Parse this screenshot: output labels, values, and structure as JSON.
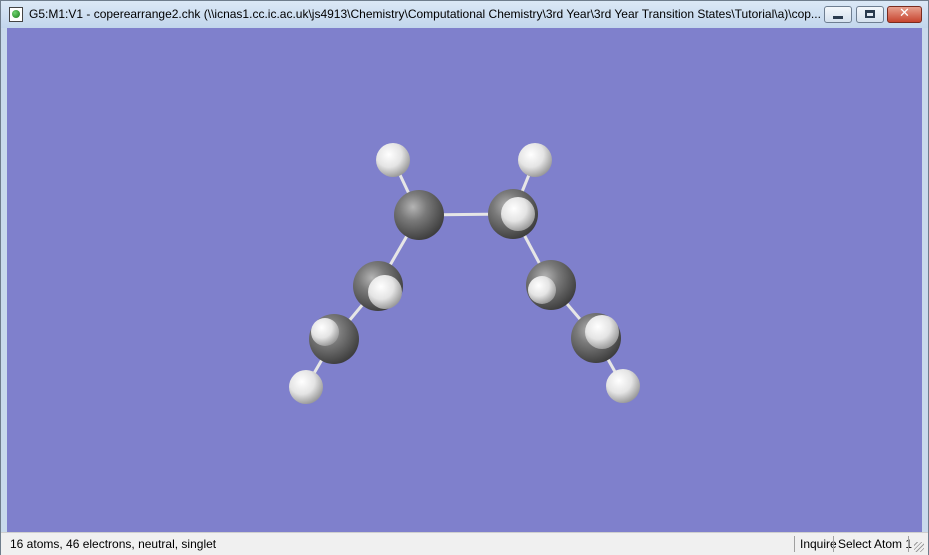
{
  "window": {
    "title": "G5:M1:V1 - coperearrange2.chk (\\\\icnas1.cc.ic.ac.uk\\js4913\\Chemistry\\Computational Chemistry\\3rd Year\\3rd Year Transition States\\Tutorial\\a)\\cop...",
    "close_glyph": "✕"
  },
  "colors": {
    "viewport_background": "#7f80cc",
    "carbon_atom": "#6e6e6e",
    "hydrogen_atom": "#f2f2f2",
    "bond": "#e6e6e6"
  },
  "status": {
    "molecule_info": "16 atoms, 46 electrons, neutral, singlet",
    "mode": "Inquire",
    "selection": "Select Atom 1"
  }
}
